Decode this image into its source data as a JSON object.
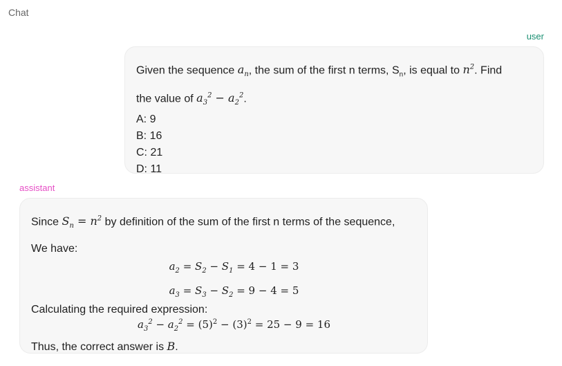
{
  "app": {
    "title": "Chat"
  },
  "messages": [
    {
      "role": "user",
      "label": "user",
      "lines": {
        "intro_a": "Given the sequence ",
        "intro_b": ", the sum of the first n terms, S",
        "intro_b_sub": "n",
        "intro_c": ", is equal to ",
        "intro_d": ". Find",
        "line2_a": "the value of ",
        "line2_end": ".",
        "options": [
          "A: 9",
          "B: 16",
          "C: 21",
          "D: 11"
        ]
      }
    },
    {
      "role": "assistant",
      "label": "assistant",
      "lines": {
        "since_a": "Since ",
        "since_b": " by definition of the sum of the first n terms of the sequence,",
        "we_have": "We have:",
        "calc": "Calculating the required expression:",
        "thus_a": "Thus, the correct answer is ",
        "thus_b": "B",
        "thus_c": "."
      }
    }
  ]
}
